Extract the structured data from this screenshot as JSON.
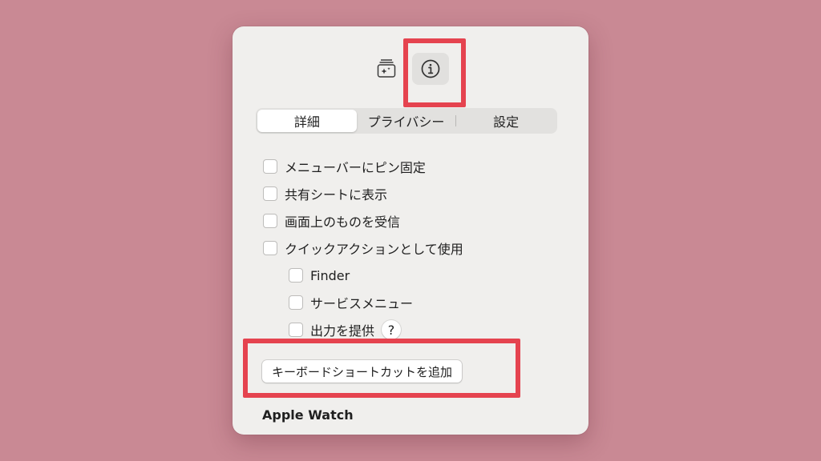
{
  "toolbar": {
    "icons": [
      "gallery-icon",
      "info-icon"
    ]
  },
  "tabs": [
    {
      "label": "詳細",
      "active": true
    },
    {
      "label": "プライバシー",
      "active": false
    },
    {
      "label": "設定",
      "active": false
    }
  ],
  "options": {
    "pin_menu_bar": "メニューバーにピン固定",
    "show_share_sheet": "共有シートに表示",
    "receive_screen": "画面上のものを受信",
    "use_quick_action": "クイックアクションとして使用",
    "finder": "Finder",
    "services_menu": "サービスメニュー",
    "provide_output": "出力を提供",
    "help": "?"
  },
  "shortcut_button": "キーボードショートカットを追加",
  "next_section": "Apple Watch",
  "colors": {
    "background": "#c98994",
    "panel": "#f0efed",
    "highlight": "#e5434f"
  }
}
